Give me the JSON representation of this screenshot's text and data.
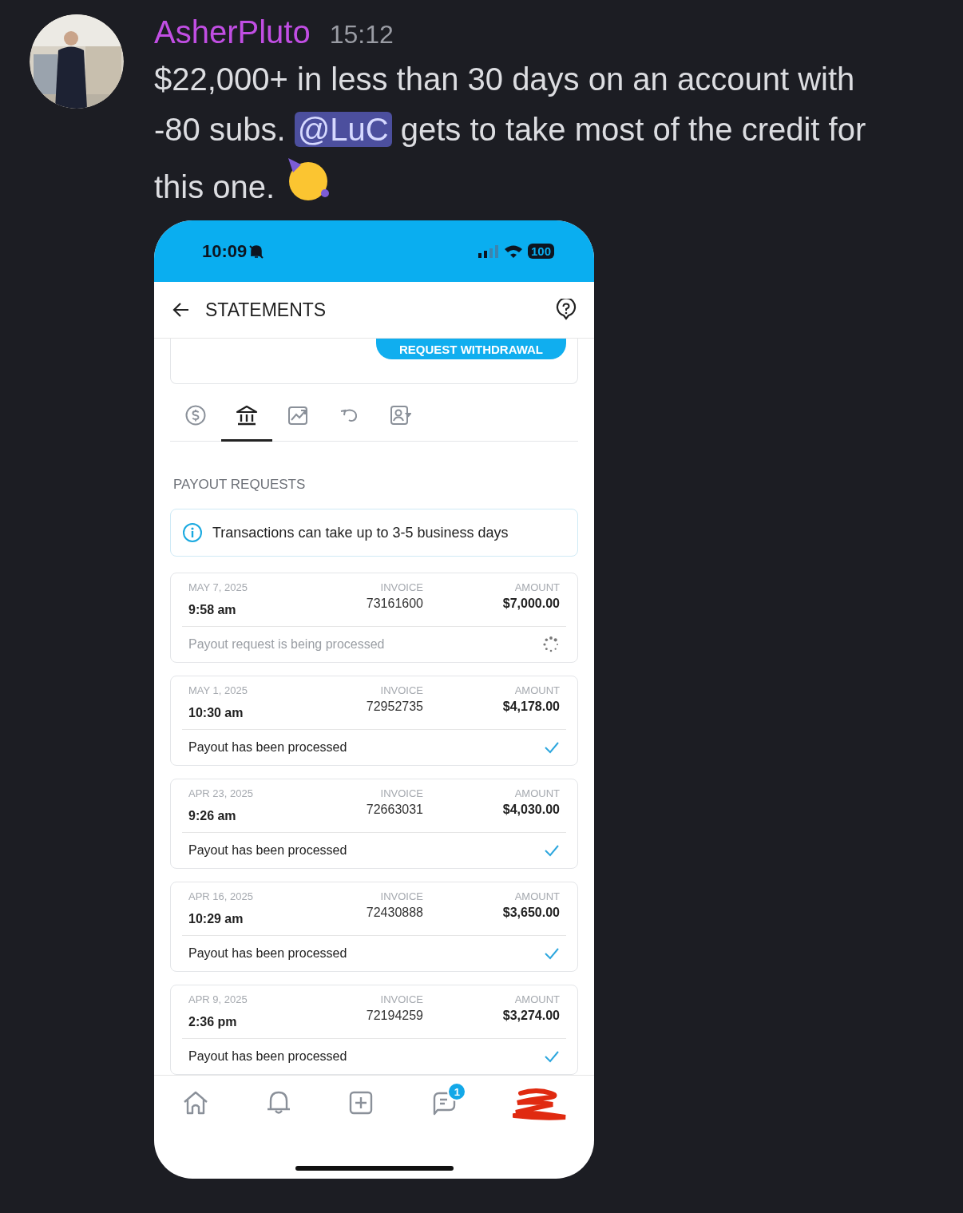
{
  "message": {
    "author": "AsherPluto",
    "time": "15:12",
    "text_before": "$22,000+ in less than 30 days on an account with -80 subs.",
    "mention": "@LuC",
    "text_after": "gets to take most of the credit for this one."
  },
  "phone": {
    "status_bar": {
      "time": "10:09",
      "battery": "100"
    },
    "header": {
      "title": "STATEMENTS"
    },
    "withdraw_button": "REQUEST WITHDRAWAL",
    "tabs": [
      {
        "kind": "dollar",
        "selected": false
      },
      {
        "kind": "bank",
        "selected": true
      },
      {
        "kind": "chart",
        "selected": false
      },
      {
        "kind": "undo",
        "selected": false
      },
      {
        "kind": "contact",
        "selected": false
      }
    ],
    "section_title": "PAYOUT REQUESTS",
    "info_banner": "Transactions can take up to 3-5 business days",
    "payouts": [
      {
        "date": "MAY 7, 2025",
        "time": "9:58 am",
        "invoice_label": "INVOICE",
        "invoice": "73161600",
        "amount_label": "AMOUNT",
        "amount": "$7,000.00",
        "status": "Payout request is being processed",
        "kind": "pending"
      },
      {
        "date": "MAY 1, 2025",
        "time": "10:30 am",
        "invoice_label": "INVOICE",
        "invoice": "72952735",
        "amount_label": "AMOUNT",
        "amount": "$4,178.00",
        "status": "Payout has been processed",
        "kind": "done"
      },
      {
        "date": "APR 23, 2025",
        "time": "9:26 am",
        "invoice_label": "INVOICE",
        "invoice": "72663031",
        "amount_label": "AMOUNT",
        "amount": "$4,030.00",
        "status": "Payout has been processed",
        "kind": "done"
      },
      {
        "date": "APR 16, 2025",
        "time": "10:29 am",
        "invoice_label": "INVOICE",
        "invoice": "72430888",
        "amount_label": "AMOUNT",
        "amount": "$3,650.00",
        "status": "Payout has been processed",
        "kind": "done"
      },
      {
        "date": "APR 9, 2025",
        "time": "2:36 pm",
        "invoice_label": "INVOICE",
        "invoice": "72194259",
        "amount_label": "AMOUNT",
        "amount": "$3,274.00",
        "status": "Payout has been processed",
        "kind": "done"
      }
    ],
    "nav": [
      {
        "kind": "home"
      },
      {
        "kind": "bell"
      },
      {
        "kind": "add"
      },
      {
        "kind": "chat",
        "badge": "1"
      },
      {
        "kind": "profile"
      }
    ]
  }
}
